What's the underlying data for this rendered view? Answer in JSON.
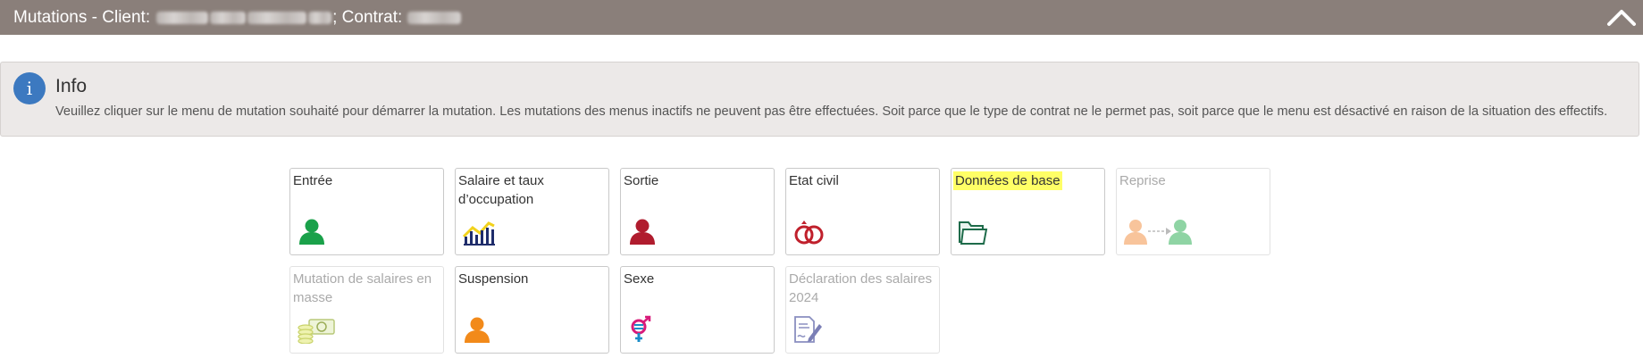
{
  "header": {
    "title_prefix": "Mutations - Client:",
    "contract_prefix": "; Contrat:"
  },
  "info": {
    "title": "Info",
    "message": "Veuillez cliquer sur le menu de mutation souhaité pour démarrer la mutation. Les mutations des menus inactifs ne peuvent pas être effectuées. Soit parce que le type de contrat ne le permet pas, soit parce que le menu est désactivé en raison de la situation des effectifs."
  },
  "tiles": [
    {
      "label": "Entrée",
      "icon": "person-icon",
      "color": "#1aa14a",
      "active": true
    },
    {
      "label": "Salaire et taux d’occupation",
      "icon": "salary-chart-icon",
      "color": "#1f2d6b",
      "active": true
    },
    {
      "label": "Sortie",
      "icon": "person-icon",
      "color": "#b01c2e",
      "active": true
    },
    {
      "label": "Etat civil",
      "icon": "rings-icon",
      "color": "#c0202c",
      "active": true
    },
    {
      "label": "Données de base",
      "icon": "folder-icon",
      "color": "#1e6b4a",
      "active": true,
      "highlighted": true
    },
    {
      "label": "Reprise",
      "icon": "transfer-persons-icon",
      "color": "#f6b27a",
      "active": false
    },
    {
      "label": "Mutation de salaires en masse",
      "icon": "money-icon",
      "color": "#c8d86a",
      "active": false
    },
    {
      "label": "Suspension",
      "icon": "person-icon",
      "color": "#f28a1a",
      "active": true
    },
    {
      "label": "Sexe",
      "icon": "gender-icon",
      "color": "#d81b7a",
      "active": true
    },
    {
      "label": "Déclaration des salaires 2024",
      "icon": "document-sign-icon",
      "color": "#7b7fb6",
      "active": false
    }
  ]
}
